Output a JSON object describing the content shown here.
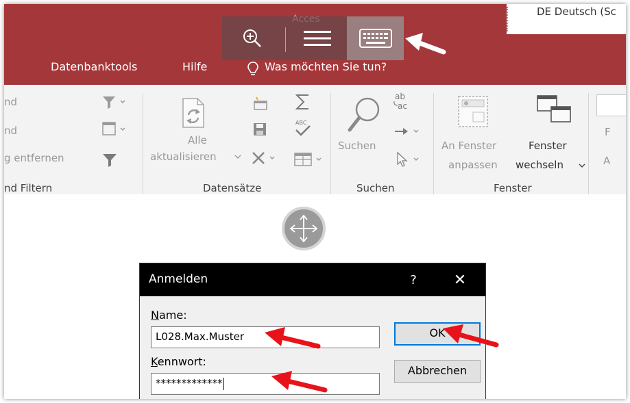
{
  "language": {
    "label": "DE Deutsch (Sc"
  },
  "app": {
    "ghost_title": "Acces"
  },
  "touchbar": {
    "zoom_icon": "zoom-in-icon",
    "menu_icon": "hamburger-icon",
    "keyboard_icon": "keyboard-icon"
  },
  "ribbon_tabs": {
    "database_tools": "Datenbanktools",
    "help": "Hilfe",
    "tell_me": "Was möchten Sie tun?"
  },
  "ribbon": {
    "sort_filter": {
      "item1": "nd",
      "item2": "nd",
      "item3": "g entfernen",
      "label": "nd Filtern"
    },
    "records": {
      "refresh_line1": "Alle",
      "refresh_line2": "aktualisieren",
      "label": "Datensätze"
    },
    "find": {
      "search": "Suchen",
      "label": "Suchen"
    },
    "window": {
      "fit_line1": "An Fenster",
      "fit_line2": "anpassen",
      "switch_line1": "Fenster",
      "switch_line2": "wechseln",
      "label": "Fenster"
    },
    "text_format": {
      "f": "F",
      "a": "A"
    }
  },
  "dialog": {
    "title": "Anmelden",
    "help": "?",
    "close": "✕",
    "name_label": "Name:",
    "name_value": "L028.Max.Muster",
    "password_label": "Kennwort:",
    "password_value": "*************",
    "ok": "OK",
    "cancel": "Abbrechen"
  },
  "colors": {
    "ribbon_red": "#a4373a",
    "arrow_red": "#e8121a",
    "focus_blue": "#0078d7"
  }
}
